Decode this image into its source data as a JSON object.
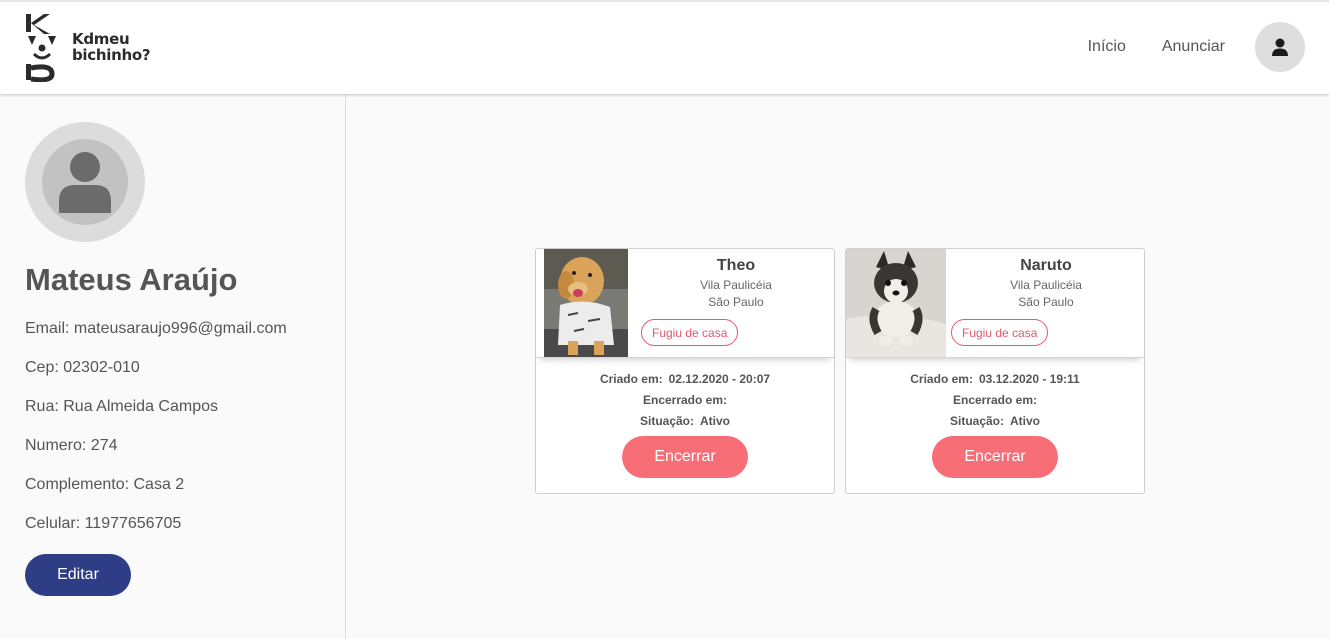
{
  "header": {
    "brand_line1": "Kdmeu",
    "brand_line2": "bichinho?",
    "nav": {
      "inicio": "Início",
      "anunciar": "Anunciar"
    }
  },
  "profile": {
    "name": "Mateus Araújo",
    "email": "Email: mateusaraujo996@gmail.com",
    "cep": "Cep: 02302-010",
    "rua": "Rua: Rua Almeida Campos",
    "numero": "Numero: 274",
    "complemento": "Complemento: Casa 2",
    "celular": "Celular: 11977656705",
    "edit_label": "Editar"
  },
  "cards": [
    {
      "name": "Theo",
      "district": "Vila Paulicéia",
      "city": "São Paulo",
      "tag": "Fugiu de casa",
      "created_label": "Criado em:",
      "created_value": "02.12.2020 - 20:07",
      "ended_label": "Encerrado em:",
      "status_label": "Situação:",
      "status_value": "Ativo",
      "action": "Encerrar"
    },
    {
      "name": "Naruto",
      "district": "Vila Paulicéia",
      "city": "São Paulo",
      "tag": "Fugiu de casa",
      "created_label": "Criado em:",
      "created_value": "03.12.2020 - 19:11",
      "ended_label": "Encerrado em:",
      "status_label": "Situação:",
      "status_value": "Ativo",
      "action": "Encerrar"
    }
  ],
  "colors": {
    "primary": "#2f3c86",
    "accent": "#f76e77",
    "tag": "#e2596c"
  }
}
